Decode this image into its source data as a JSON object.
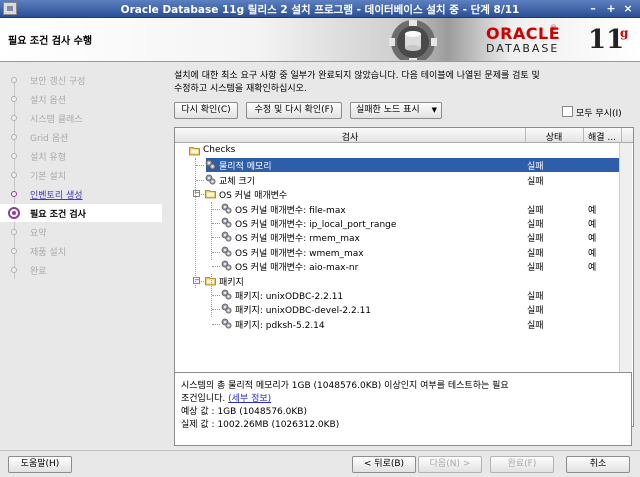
{
  "window": {
    "title": "Oracle Database 11g 릴리스 2 설치 프로그램 - 데이터베이스 설치 중 - 단계 8/11",
    "controls": [
      "–",
      "+",
      "×"
    ]
  },
  "header": {
    "page_title": "필요 조건 검사 수행",
    "logo_oracle": "ORACLE",
    "logo_registered": "®",
    "logo_database": "DATABASE",
    "logo_version": "11",
    "logo_g": "g"
  },
  "steps": [
    {
      "label": "보안 갱신 구성",
      "state": "done"
    },
    {
      "label": "설치 옵션",
      "state": "done"
    },
    {
      "label": "시스템 클래스",
      "state": "done"
    },
    {
      "label": "Grid 옵션",
      "state": "done"
    },
    {
      "label": "설치 유형",
      "state": "done"
    },
    {
      "label": "기본 설치",
      "state": "done"
    },
    {
      "label": "인벤토리 생성",
      "state": "link"
    },
    {
      "label": "필요 조건 검사",
      "state": "current"
    },
    {
      "label": "요약",
      "state": "todo"
    },
    {
      "label": "제품 설치",
      "state": "todo"
    },
    {
      "label": "완료",
      "state": "todo"
    }
  ],
  "main": {
    "description_line1": "설치에 대한 최소 요구 사항 중 일부가 완료되지 않았습니다. 다음 테이블에 나열된 문제를 검토 및",
    "description_line2": "수정하고 시스템을 재확인하십시오.",
    "recheck_button": "다시 확인(C)",
    "fix_recheck_button": "수정 및 다시 확인(F)",
    "show_failed_button": "실패한 노드 표시",
    "ignore_all_label": "모두 무시(I)",
    "columns": {
      "check": "검사",
      "status": "상태",
      "fixable": "해결 ..."
    },
    "rows": [
      {
        "name": "Checks",
        "indent": 0,
        "status": "",
        "fixable": "",
        "icon": "folder",
        "selected": false
      },
      {
        "name": "물리적 메모리",
        "indent": 1,
        "status": "실패",
        "fixable": "",
        "icon": "gear",
        "selected": true
      },
      {
        "name": "교체 크기",
        "indent": 1,
        "status": "실패",
        "fixable": "",
        "icon": "gear",
        "selected": false
      },
      {
        "name": "OS 커널 매개변수",
        "indent": 1,
        "status": "",
        "fixable": "",
        "icon": "folder",
        "selected": false
      },
      {
        "name": "OS 커널 매개변수: file-max",
        "indent": 2,
        "status": "실패",
        "fixable": "예",
        "icon": "gear",
        "selected": false
      },
      {
        "name": "OS 커널 매개변수: ip_local_port_range",
        "indent": 2,
        "status": "실패",
        "fixable": "예",
        "icon": "gear",
        "selected": false
      },
      {
        "name": "OS 커널 매개변수: rmem_max",
        "indent": 2,
        "status": "실패",
        "fixable": "예",
        "icon": "gear",
        "selected": false
      },
      {
        "name": "OS 커널 매개변수: wmem_max",
        "indent": 2,
        "status": "실패",
        "fixable": "예",
        "icon": "gear",
        "selected": false
      },
      {
        "name": "OS 커널 매개변수: aio-max-nr",
        "indent": 2,
        "status": "실패",
        "fixable": "예",
        "icon": "gear",
        "selected": false
      },
      {
        "name": "패키지",
        "indent": 1,
        "status": "",
        "fixable": "",
        "icon": "folder",
        "selected": false
      },
      {
        "name": "패키지: unixODBC-2.2.11",
        "indent": 2,
        "status": "실패",
        "fixable": "",
        "icon": "gear",
        "selected": false
      },
      {
        "name": "패키지: unixODBC-devel-2.2.11",
        "indent": 2,
        "status": "실패",
        "fixable": "",
        "icon": "gear",
        "selected": false
      },
      {
        "name": "패키지: pdksh-5.2.14",
        "indent": 2,
        "status": "실패",
        "fixable": "",
        "icon": "gear",
        "selected": false
      }
    ],
    "info_line1": "시스템의 총 물리적 메모리가 1GB (1048576.0KB) 이상인지 여부를 테스트하는 필요",
    "info_line2_prefix": "조건입니다.",
    "info_link": "(세부 정보)",
    "info_expected": "예상 값 : 1GB (1048576.0KB)",
    "info_actual": "실제 값 : 1002.26MB (1026312.0KB)"
  },
  "footer": {
    "help_button": "도움말(H)",
    "back_button": "< 뒤로(B)",
    "next_button": "다음(N) >",
    "finish_button": "완료(F)",
    "cancel_button": "취소"
  }
}
